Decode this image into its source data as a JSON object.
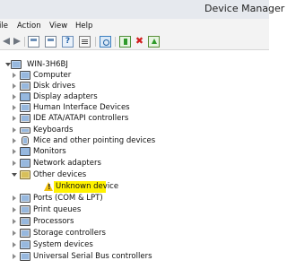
{
  "window": {
    "title": "Device Manager"
  },
  "menu": [
    {
      "label": "ile"
    },
    {
      "label": "Action"
    },
    {
      "label": "View"
    },
    {
      "label": "Help"
    }
  ],
  "toolbar": [
    {
      "name": "back-arrow-icon"
    },
    {
      "name": "forward-arrow-icon"
    },
    {
      "name": "show-hide-console-tree-icon"
    },
    {
      "name": "properties-icon"
    },
    {
      "name": "help-icon",
      "glyph": "?"
    },
    {
      "name": "properties-sheet-icon"
    },
    {
      "name": "scan-for-hardware-changes-icon"
    },
    {
      "name": "update-driver-icon"
    },
    {
      "name": "uninstall-device-icon",
      "glyph": "✖"
    },
    {
      "name": "enable-device-icon"
    }
  ],
  "tree": {
    "root": {
      "label": "WIN-3H6BJ",
      "expanded": true
    },
    "categories": [
      {
        "label": "Computer",
        "icon": "computer-icon",
        "expanded": false
      },
      {
        "label": "Disk drives",
        "icon": "disk-drive-icon",
        "expanded": false
      },
      {
        "label": "Display adapters",
        "icon": "display-adapter-icon",
        "expanded": false
      },
      {
        "label": "Human Interface Devices",
        "icon": "hid-icon",
        "expanded": false
      },
      {
        "label": "IDE ATA/ATAPI controllers",
        "icon": "ide-controller-icon",
        "expanded": false
      },
      {
        "label": "Keyboards",
        "icon": "keyboard-icon",
        "expanded": false
      },
      {
        "label": "Mice and other pointing devices",
        "icon": "mouse-icon",
        "expanded": false
      },
      {
        "label": "Monitors",
        "icon": "monitor-icon",
        "expanded": false
      },
      {
        "label": "Network adapters",
        "icon": "network-adapter-icon",
        "expanded": false
      },
      {
        "label": "Other devices",
        "icon": "other-devices-icon",
        "expanded": true,
        "children": [
          {
            "label": "Unknown device",
            "icon": "warning-icon",
            "highlighted": true,
            "highlight_color": "#fff200"
          }
        ]
      },
      {
        "label": "Ports (COM & LPT)",
        "icon": "port-icon",
        "expanded": false
      },
      {
        "label": "Print queues",
        "icon": "printer-icon",
        "expanded": false
      },
      {
        "label": "Processors",
        "icon": "processor-icon",
        "expanded": false
      },
      {
        "label": "Storage controllers",
        "icon": "storage-controller-icon",
        "expanded": false
      },
      {
        "label": "System devices",
        "icon": "system-devices-icon",
        "expanded": false
      },
      {
        "label": "Universal Serial Bus controllers",
        "icon": "usb-controller-icon",
        "expanded": false
      }
    ]
  }
}
